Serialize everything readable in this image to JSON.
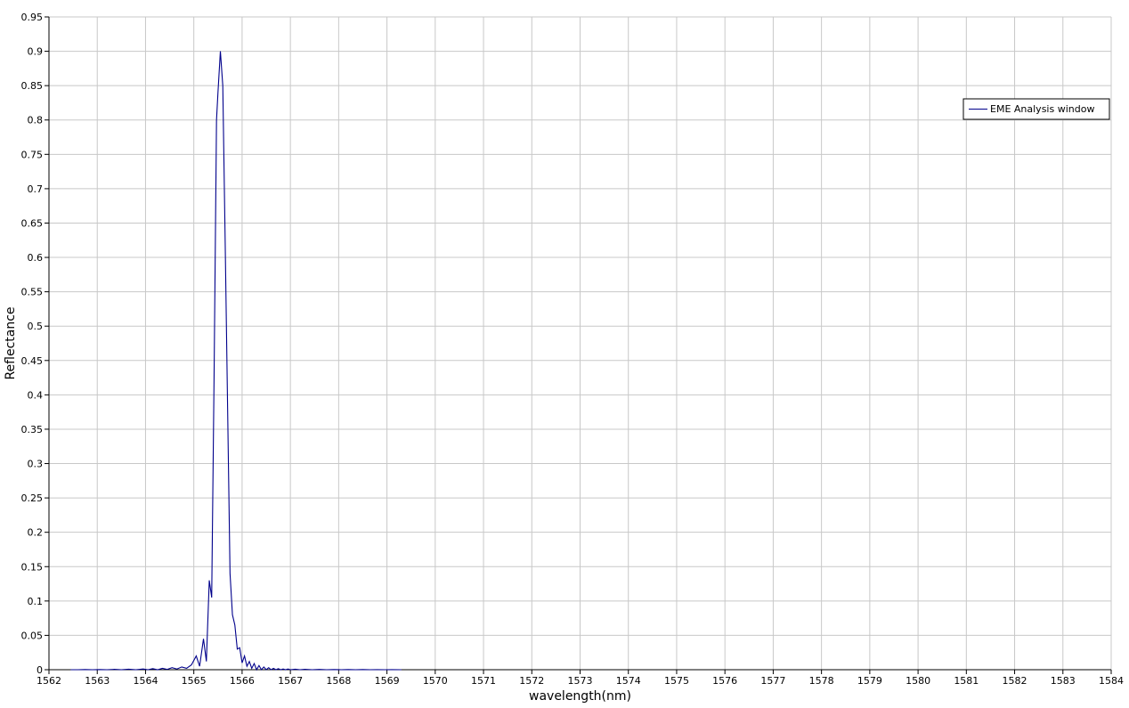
{
  "chart_data": {
    "type": "line",
    "title": "",
    "xlabel": "wavelength(nm)",
    "ylabel": "Reflectance",
    "xlim": [
      1562,
      1584
    ],
    "ylim": [
      0,
      0.95
    ],
    "x_ticks": [
      1562,
      1563,
      1564,
      1565,
      1566,
      1567,
      1568,
      1569,
      1570,
      1571,
      1572,
      1573,
      1574,
      1575,
      1576,
      1577,
      1578,
      1579,
      1580,
      1581,
      1582,
      1583,
      1584
    ],
    "x_tick_labels": [
      "1562",
      "1563",
      "1564",
      "1565",
      "1566",
      "1567",
      "1568",
      "1569",
      "1570",
      "1571",
      "1572",
      "1573",
      "1574",
      "1575",
      "1576",
      "1577",
      "1578",
      "1579",
      "1580",
      "1581",
      "1582",
      "1583",
      "1584"
    ],
    "y_ticks": [
      0,
      0.05,
      0.1,
      0.15,
      0.2,
      0.25,
      0.3,
      0.35,
      0.4,
      0.45,
      0.5,
      0.55,
      0.6,
      0.65,
      0.7,
      0.75,
      0.8,
      0.85,
      0.9,
      0.95
    ],
    "y_tick_labels": [
      "0",
      "0.05",
      "0.1",
      "0.15",
      "0.2",
      "0.25",
      "0.3",
      "0.35",
      "0.4",
      "0.45",
      "0.5",
      "0.55",
      "0.6",
      "0.65",
      "0.7",
      "0.75",
      "0.8",
      "0.85",
      "0.9",
      "0.95"
    ],
    "grid": true,
    "legend_position": "top-right",
    "series": [
      {
        "name": "EME Analysis window",
        "color": "#00008b",
        "x": [
          1562.45,
          1562.6,
          1562.75,
          1562.9,
          1563.05,
          1563.2,
          1563.35,
          1563.5,
          1563.65,
          1563.8,
          1563.95,
          1564.05,
          1564.15,
          1564.25,
          1564.35,
          1564.45,
          1564.55,
          1564.65,
          1564.75,
          1564.85,
          1564.95,
          1565.05,
          1565.12,
          1565.2,
          1565.26,
          1565.32,
          1565.37,
          1565.42,
          1565.47,
          1565.5,
          1565.55,
          1565.6,
          1565.65,
          1565.7,
          1565.75,
          1565.8,
          1565.85,
          1565.9,
          1565.95,
          1566.0,
          1566.05,
          1566.1,
          1566.15,
          1566.2,
          1566.25,
          1566.3,
          1566.35,
          1566.4,
          1566.45,
          1566.5,
          1566.55,
          1566.6,
          1566.65,
          1566.7,
          1566.75,
          1566.8,
          1566.85,
          1566.9,
          1566.95,
          1567.0,
          1567.1,
          1567.2,
          1567.3,
          1567.45,
          1567.6,
          1567.75,
          1567.9,
          1568.05,
          1568.2,
          1568.35,
          1568.5,
          1568.65,
          1568.8,
          1568.95,
          1569.1,
          1569.3
        ],
        "values": [
          0,
          0,
          0.0003,
          0,
          0.0003,
          0,
          0.0005,
          0,
          0.0007,
          0,
          0.001,
          0,
          0.0015,
          0,
          0.002,
          0.0005,
          0.003,
          0.001,
          0.004,
          0.002,
          0.007,
          0.02,
          0.005,
          0.045,
          0.012,
          0.13,
          0.105,
          0.43,
          0.8,
          0.84,
          0.9,
          0.85,
          0.62,
          0.38,
          0.14,
          0.08,
          0.065,
          0.03,
          0.032,
          0.01,
          0.02,
          0.005,
          0.012,
          0.002,
          0.009,
          0,
          0.006,
          0,
          0.004,
          0,
          0.003,
          0,
          0.002,
          0,
          0.0015,
          0,
          0.001,
          0,
          0.001,
          0,
          0.0007,
          0,
          0.0005,
          0,
          0.0004,
          0,
          0.0003,
          0,
          0.0002,
          0,
          0.0002,
          0,
          0.0001,
          0,
          0.0001,
          0
        ]
      }
    ]
  }
}
